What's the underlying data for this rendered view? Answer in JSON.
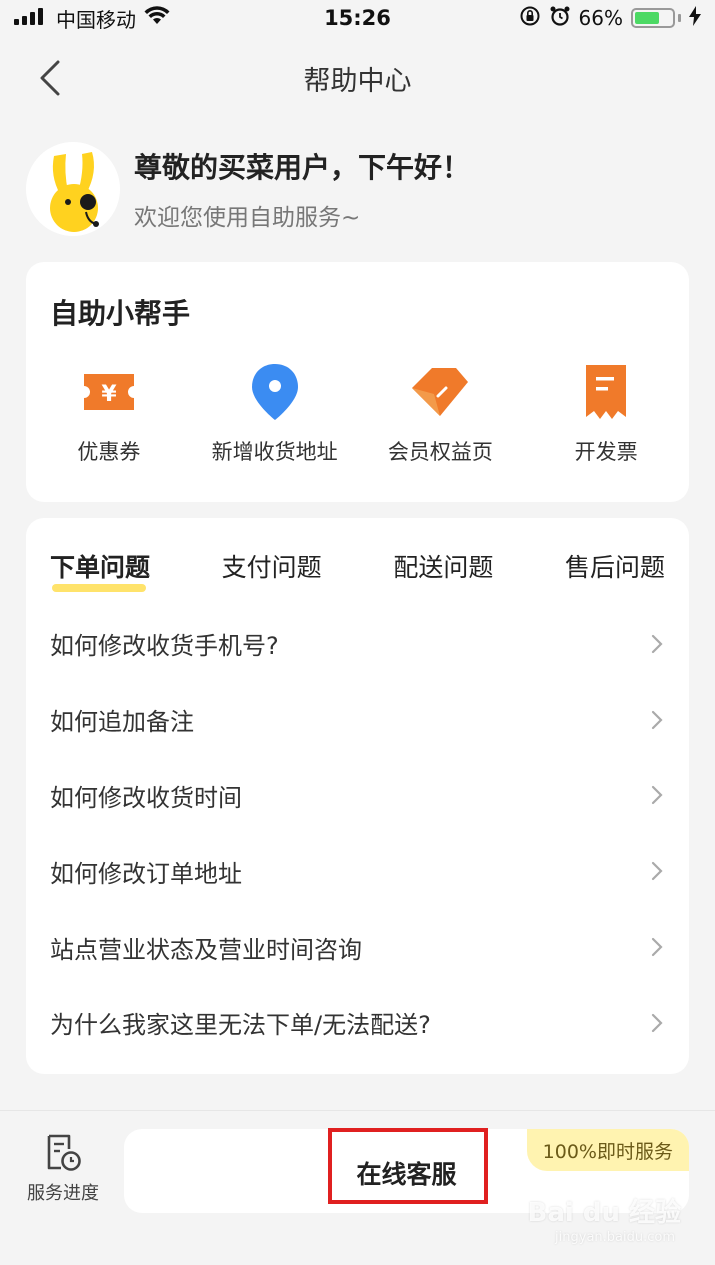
{
  "status_bar": {
    "carrier": "中国移动",
    "time": "15:26",
    "battery_percent": "66%",
    "battery_level": 0.66,
    "battery_color": "#4cd964"
  },
  "nav": {
    "title": "帮助中心",
    "back_icon": "chevron-left-icon"
  },
  "greeting": {
    "title": "尊敬的买菜用户，下午好！",
    "subtitle": "欢迎您使用自助服务~"
  },
  "helper": {
    "title": "自助小帮手",
    "items": [
      {
        "label": "优惠券",
        "icon": "coupon-icon",
        "color": "#f07a2a"
      },
      {
        "label": "新增收货地址",
        "icon": "location-pin-icon",
        "color": "#3b8cf2"
      },
      {
        "label": "会员权益页",
        "icon": "tag-icon",
        "color": "#f07a2a"
      },
      {
        "label": "开发票",
        "icon": "receipt-icon",
        "color": "#f07a2a"
      }
    ]
  },
  "faq": {
    "tabs": [
      {
        "label": "下单问题",
        "active": true
      },
      {
        "label": "支付问题",
        "active": false
      },
      {
        "label": "配送问题",
        "active": false
      },
      {
        "label": "售后问题",
        "active": false
      }
    ],
    "items": [
      "如何修改收货手机号?",
      "如何追加备注",
      "如何修改收货时间",
      "如何修改订单地址",
      "站点营业状态及营业时间咨询",
      "为什么我家这里无法下单/无法配送?"
    ],
    "accent_color": "#ffe36b"
  },
  "bottom": {
    "progress_label": "服务进度",
    "service_label": "在线客服",
    "service_badge": "100%即时服务",
    "highlight_color": "#e02020"
  },
  "watermark": {
    "brand": "Bai du 经验",
    "url": "jingyan.baidu.com"
  }
}
